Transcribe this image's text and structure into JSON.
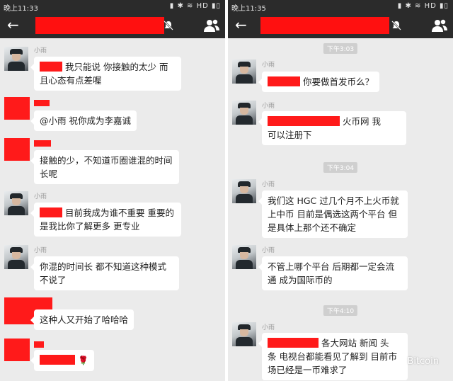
{
  "left": {
    "status_time": "晚上11:33",
    "status_icons": "▮ ✱ ≋ HD ▮▯",
    "sender_name": "小雨",
    "messages": [
      {
        "sender": "小雨",
        "text": "我只能说 你接触的太少 而且心态有点差喔"
      },
      {
        "sender": "",
        "text": "@小雨 祝你成为李嘉诚"
      },
      {
        "sender": "",
        "text": "接触的少，不知道币圈谁混的时间长呢"
      },
      {
        "sender": "小雨",
        "text": "目前我成为谁不重要  重要的是我比你了解更多 更专业"
      },
      {
        "sender": "小雨",
        "text": "你混的时间长 都不知道这种模式不说了"
      },
      {
        "sender": "",
        "text": "这种人又开始了哈哈哈"
      },
      {
        "sender": "",
        "text": "🌹"
      }
    ]
  },
  "right": {
    "status_time": "晚上11:35",
    "status_icons": "▮ ✱ ≋ HD ▮▯",
    "timestamps": [
      "下午3:03",
      "下午3:04",
      "下午4:10"
    ],
    "messages": [
      {
        "sender": "小雨",
        "text": "你要做首发币么？"
      },
      {
        "sender": "小雨",
        "text_part1": "火币网 我",
        "text_part2": "可以注册下"
      },
      {
        "sender": "小雨",
        "text": "我们这 HGC 过几个月不上火币就上中币  目前是偶选这两个平台 但是具体上那个还不确定"
      },
      {
        "sender": "小雨",
        "text": "不管上哪个平台  后期都一定会流通 成为国际币的"
      },
      {
        "sender": "小雨",
        "text_part1": "各大网站  新闻  头",
        "text_part2": "条 电视台都能看见了解到  目前市",
        "text_part3": "场已经是一币难求了"
      }
    ]
  },
  "watermark": "Bitcoin",
  "colors": {
    "topbar": "#2b2b2b",
    "background": "#ebebeb",
    "redaction": "#ff1a1a",
    "bubble": "#ffffff"
  }
}
